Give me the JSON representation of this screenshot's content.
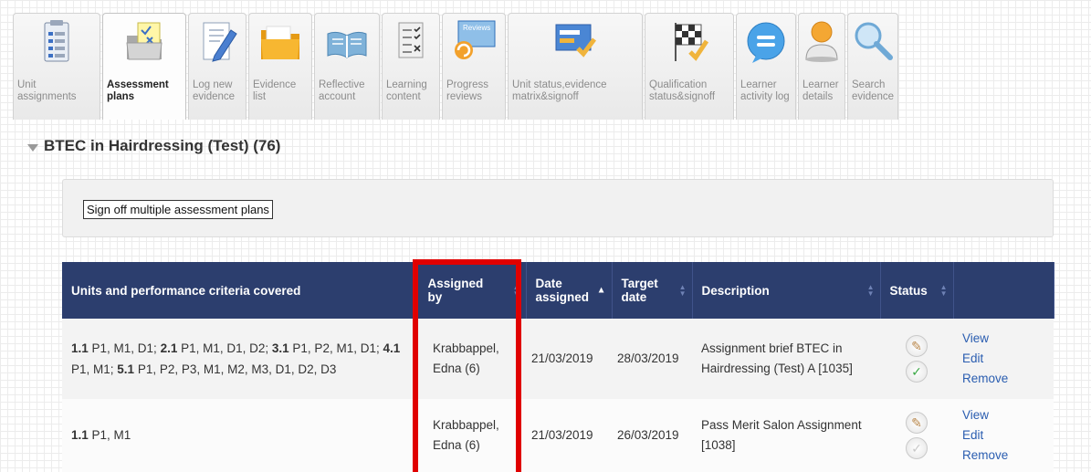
{
  "toolbar": {
    "tabs": [
      {
        "label": "Unit\nassignments",
        "icon": "clipboard-list-icon"
      },
      {
        "label": "Assessment\nplans",
        "icon": "folder-plan-icon",
        "active": true
      },
      {
        "label": "Log new\nevidence",
        "icon": "pencil-document-icon"
      },
      {
        "label": "Evidence\nlist",
        "icon": "folder-icon"
      },
      {
        "label": "Reflective\naccount",
        "icon": "open-book-icon"
      },
      {
        "label": "Learning\ncontent",
        "icon": "checklist-icon"
      },
      {
        "label": "Progress\nreviews",
        "icon": "reviews-icon",
        "badge": "Reviews"
      },
      {
        "label": "Unit status,evidence\nmatrix&signoff",
        "icon": "matrix-check-icon"
      },
      {
        "label": "Qualification\nstatus&signoff",
        "icon": "checkered-flag-icon"
      },
      {
        "label": "Learner\nactivity log",
        "icon": "chat-bubble-icon"
      },
      {
        "label": "Learner\ndetails",
        "icon": "user-icon"
      },
      {
        "label": "Search\nevidence",
        "icon": "magnifier-icon"
      }
    ]
  },
  "section": {
    "title": "BTEC in Hairdressing (Test) (76)"
  },
  "actions": {
    "sign_off_label": "Sign off multiple assessment plans"
  },
  "table": {
    "headers": {
      "units": "Units and performance criteria covered",
      "assigned_by": "Assigned by",
      "date_assigned": "Date assigned",
      "target_date": "Target date",
      "description": "Description",
      "status": "Status"
    },
    "rows": [
      {
        "criteria": [
          {
            "unit": "1.1",
            "items": " P1, M1, D1; "
          },
          {
            "unit": "2.1",
            "items": " P1, M1, D1, D2; "
          },
          {
            "unit": "3.1",
            "items": " P1, P2, M1, D1; "
          },
          {
            "unit": "4.1",
            "items": " P1, M1; "
          },
          {
            "unit": "5.1",
            "items": " P1, P2, P3, M1, M2, M3, D1, D2, D3"
          }
        ],
        "assigned_by": "Krabbappel, Edna (6)",
        "date_assigned": "21/03/2019",
        "target_date": "28/03/2019",
        "description": "Assignment brief BTEC in Hairdressing (Test) A [1035]",
        "signed_off": true,
        "view": "View",
        "edit": "Edit",
        "remove": "Remove"
      },
      {
        "criteria": [
          {
            "unit": "1.1",
            "items": " P1, M1"
          }
        ],
        "assigned_by": "Krabbappel, Edna (6)",
        "date_assigned": "21/03/2019",
        "target_date": "26/03/2019",
        "description": "Pass Merit Salon Assignment [1038]",
        "signed_off": false,
        "view": "View",
        "edit": "Edit",
        "remove": "Remove"
      }
    ]
  },
  "colors": {
    "header_bg": "#2c3e6e",
    "highlight": "#e00000",
    "link": "#2a5db0"
  }
}
